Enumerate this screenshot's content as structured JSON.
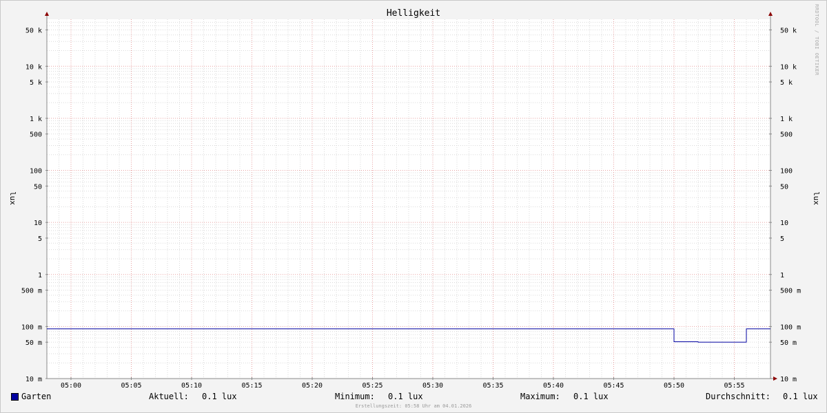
{
  "title": "Helligkeit",
  "watermark": "RRDTOOL / TOBI OETIKER",
  "colors": {
    "background": "#f3f3f3",
    "plot_background": "#ffffff",
    "minor_grid": "#d9d9d9",
    "major_grid": "#e8a0a0",
    "series": "#0000a0"
  },
  "chart_data": {
    "type": "line",
    "y_scale": "log",
    "ylabel_left": "lux",
    "ylabel_right": "lux",
    "ylim": [
      0.01,
      80000
    ],
    "xlim": [
      "04:58",
      "05:58"
    ],
    "x_ticks": [
      "05:00",
      "05:05",
      "05:10",
      "05:15",
      "05:20",
      "05:25",
      "05:30",
      "05:35",
      "05:40",
      "05:45",
      "05:50",
      "05:55"
    ],
    "y_ticks": [
      {
        "value": 50000,
        "label": "50 k"
      },
      {
        "value": 10000,
        "label": "10 k"
      },
      {
        "value": 5000,
        "label": "5 k"
      },
      {
        "value": 1000,
        "label": "1 k"
      },
      {
        "value": 500,
        "label": "500"
      },
      {
        "value": 100,
        "label": "100"
      },
      {
        "value": 50,
        "label": "50"
      },
      {
        "value": 10,
        "label": "10"
      },
      {
        "value": 5,
        "label": "5"
      },
      {
        "value": 1,
        "label": "1"
      },
      {
        "value": 0.5,
        "label": "500 m"
      },
      {
        "value": 0.1,
        "label": "100 m"
      },
      {
        "value": 0.05,
        "label": "50 m"
      },
      {
        "value": 0.01,
        "label": "10 m"
      }
    ],
    "series": [
      {
        "name": "Garten",
        "step": true,
        "points": [
          {
            "x": "04:58",
            "y": 0.09
          },
          {
            "x": "05:50",
            "y": 0.09
          },
          {
            "x": "05:50",
            "y": 0.051
          },
          {
            "x": "05:52",
            "y": 0.051
          },
          {
            "x": "05:52",
            "y": 0.05
          },
          {
            "x": "05:56",
            "y": 0.05
          },
          {
            "x": "05:56",
            "y": 0.09
          },
          {
            "x": "05:58",
            "y": 0.09
          }
        ]
      }
    ]
  },
  "legend": {
    "series_name": "Garten",
    "current_label": "Aktuell:",
    "current_value": "0.1 lux",
    "min_label": "Minimum:",
    "min_value": "0.1 lux",
    "max_label": "Maximum:",
    "max_value": "0.1 lux",
    "avg_label": "Durchschnitt:",
    "avg_value": "0.1 lux"
  },
  "footer": "Erstellungszeit: 05:58 Uhr am 04.01.2026"
}
